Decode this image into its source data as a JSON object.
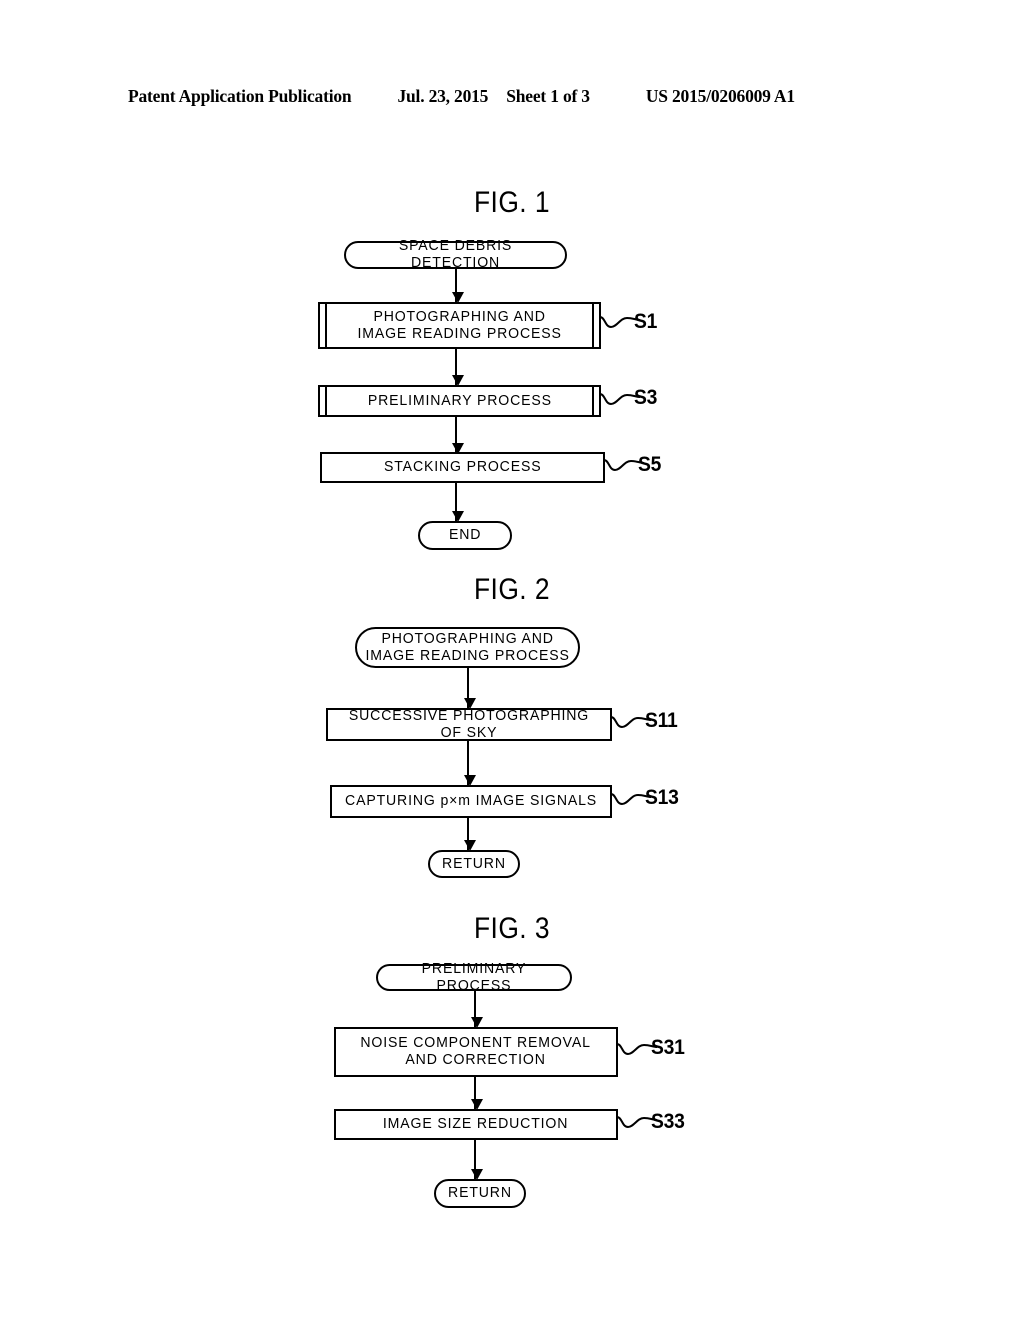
{
  "header": {
    "publication": "Patent Application Publication",
    "date": "Jul. 23, 2015",
    "sheet": "Sheet 1 of 3",
    "patent_number": "US 2015/0206009 A1"
  },
  "figures": [
    {
      "title": "FIG. 1",
      "nodes": [
        {
          "id": "fig1-start",
          "shape": "terminal",
          "text": "SPACE DEBRIS DETECTION"
        },
        {
          "id": "fig1-s1",
          "shape": "subroutine",
          "text": "PHOTOGRAPHING AND\nIMAGE READING PROCESS",
          "step": "S1"
        },
        {
          "id": "fig1-s3",
          "shape": "subroutine",
          "text": "PRELIMINARY PROCESS",
          "step": "S3"
        },
        {
          "id": "fig1-s5",
          "shape": "process",
          "text": "STACKING PROCESS",
          "step": "S5"
        },
        {
          "id": "fig1-end",
          "shape": "terminal",
          "text": "END"
        }
      ]
    },
    {
      "title": "FIG. 2",
      "nodes": [
        {
          "id": "fig2-start",
          "shape": "terminal",
          "text": "PHOTOGRAPHING AND\nIMAGE READING PROCESS"
        },
        {
          "id": "fig2-s11",
          "shape": "process",
          "text": "SUCCESSIVE PHOTOGRAPHING OF SKY",
          "step": "S11"
        },
        {
          "id": "fig2-s13",
          "shape": "process",
          "text": "CAPTURING p×m IMAGE SIGNALS",
          "step": "S13"
        },
        {
          "id": "fig2-return",
          "shape": "terminal",
          "text": "RETURN"
        }
      ]
    },
    {
      "title": "FIG. 3",
      "nodes": [
        {
          "id": "fig3-start",
          "shape": "terminal",
          "text": "PRELIMINARY PROCESS"
        },
        {
          "id": "fig3-s31",
          "shape": "process",
          "text": "NOISE COMPONENT REMOVAL\nAND CORRECTION",
          "step": "S31"
        },
        {
          "id": "fig3-s33",
          "shape": "process",
          "text": "IMAGE SIZE REDUCTION",
          "step": "S33"
        },
        {
          "id": "fig3-return",
          "shape": "terminal",
          "text": "RETURN"
        }
      ]
    }
  ],
  "fig1": {
    "title": "FIG. 1",
    "start": "SPACE DEBRIS DETECTION",
    "s1": "PHOTOGRAPHING AND\nIMAGE READING PROCESS",
    "s1_label": "S1",
    "s3": "PRELIMINARY PROCESS",
    "s3_label": "S3",
    "s5": "STACKING PROCESS",
    "s5_label": "S5",
    "end": "END"
  },
  "fig2": {
    "title": "FIG. 2",
    "start": "PHOTOGRAPHING AND\nIMAGE READING PROCESS",
    "s11": "SUCCESSIVE PHOTOGRAPHING OF SKY",
    "s11_label": "S11",
    "s13": "CAPTURING p×m IMAGE SIGNALS",
    "s13_label": "S13",
    "return": "RETURN"
  },
  "fig3": {
    "title": "FIG. 3",
    "start": "PRELIMINARY PROCESS",
    "s31": "NOISE COMPONENT REMOVAL\nAND CORRECTION",
    "s31_label": "S31",
    "s33": "IMAGE SIZE REDUCTION",
    "s33_label": "S33",
    "return": "RETURN"
  },
  "colors": {
    "ink": "#000000",
    "paper": "#ffffff"
  }
}
